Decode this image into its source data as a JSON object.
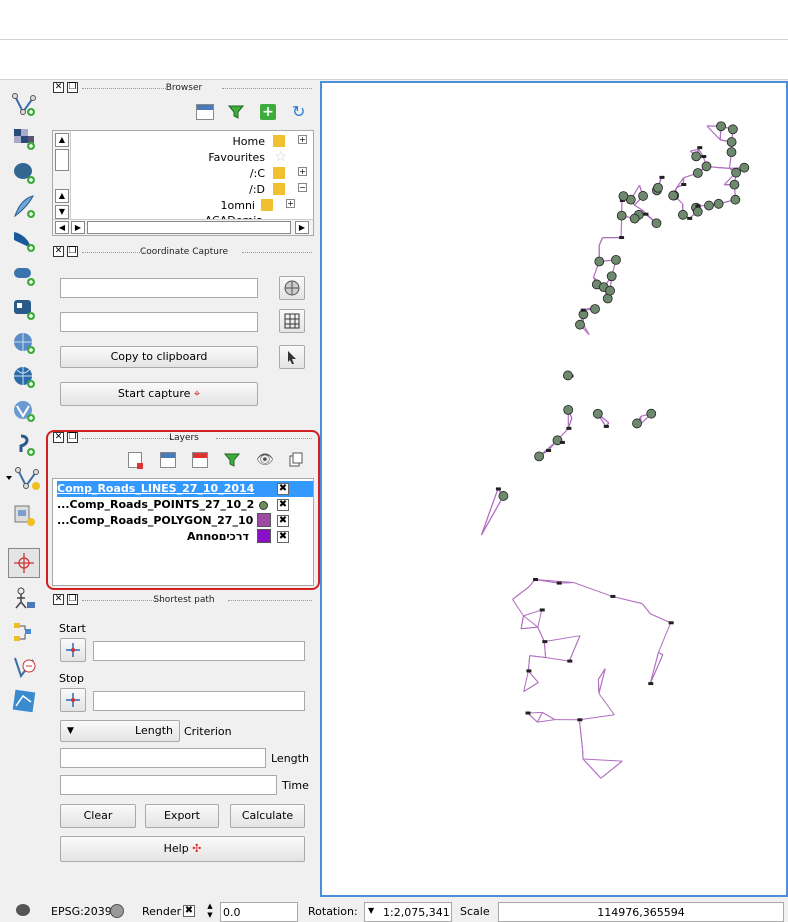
{
  "browser": {
    "title": "Browser",
    "items": [
      "Home",
      "Favourites",
      "/:C",
      "/:D",
      "1omni",
      "ACADemia"
    ]
  },
  "coord_capture": {
    "title": "Coordinate Capture",
    "copy_label": "Copy to clipboard",
    "start_label": "Start capture"
  },
  "layers": {
    "title": "Layers",
    "items": [
      {
        "name": "Comp_Roads_LINES_27_10_2014",
        "selected": true
      },
      {
        "name": "...Comp_Roads_POINTS_27_10_2",
        "selected": false
      },
      {
        "name": "...Comp_Roads_POLYGON_27_10",
        "selected": false
      },
      {
        "name": "Annoדרכים",
        "selected": false
      }
    ],
    "colors": {
      "points": "#6b8e5a",
      "polygon": "#a04aa8",
      "anno": "#8a10c8",
      "highlight": "#3399ff"
    }
  },
  "shortest": {
    "title": "Shortest path",
    "start_label": "Start",
    "stop_label": "Stop",
    "criterion_value": "Length",
    "criterion_label": "Criterion",
    "length_label": "Length",
    "time_label": "Time",
    "clear_label": "Clear",
    "export_label": "Export",
    "calculate_label": "Calculate",
    "help_label": "Help"
  },
  "status": {
    "epsg": "EPSG:2039",
    "render_label": "Render",
    "render_value": "0.0",
    "rotation_label": "Rotation:",
    "rotation_value": "1:2,075,341",
    "scale_label": "Scale",
    "coords": "114976,365594"
  },
  "map": {
    "line_color": "#b070c0",
    "point_color": "#6e8a6e"
  }
}
